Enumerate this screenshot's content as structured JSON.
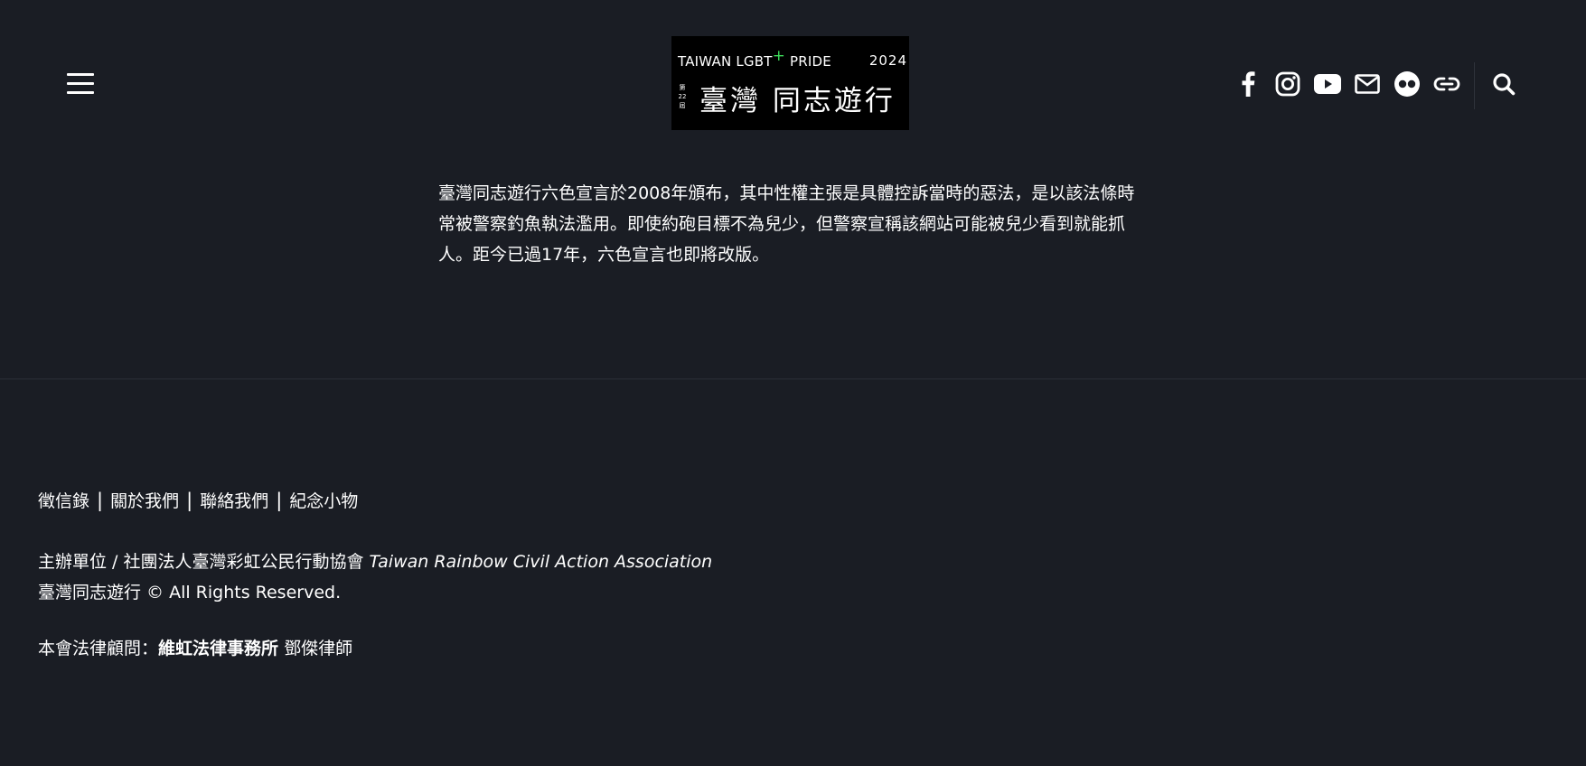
{
  "header": {
    "logo": {
      "top_text": "TAIWAN LGBT",
      "plus": "+",
      "top_text_after": " PRIDE",
      "year": "2024",
      "edition": [
        "第",
        "22",
        "屆"
      ],
      "main_text": "臺灣 同志遊行"
    },
    "social_icons": [
      "facebook-icon",
      "instagram-icon",
      "youtube-icon",
      "mail-icon",
      "flickr-icon",
      "link-icon"
    ]
  },
  "article": {
    "text": "臺灣同志遊行六色宣言於2008年頒布，其中性權主張是具體控訴當時的惡法，是以該法條時常被警察釣魚執法濫用。即使約砲目標不為兒少，但警察宣稱該網站可能被兒少看到就能抓人。距今已過17年，六色宣言也即將改版。"
  },
  "footer": {
    "links": [
      "徵信錄",
      "關於我們",
      "聯絡我們",
      "紀念小物"
    ],
    "separator": "|",
    "organizer_prefix": "主辦單位 / 社團法人臺灣彩虹公民行動協會 ",
    "organizer_en": "Taiwan Rainbow Civil Action Association",
    "copyright": "臺灣同志遊行 © All Rights Reserved.",
    "legal_prefix": "本會法律顧問：",
    "legal_firm": "維虹法律事務所",
    "legal_suffix": " 鄧傑律師"
  },
  "colors": {
    "background": "#1a1d24",
    "text": "#ffffff",
    "logo_plus": "#3ddc5a"
  }
}
